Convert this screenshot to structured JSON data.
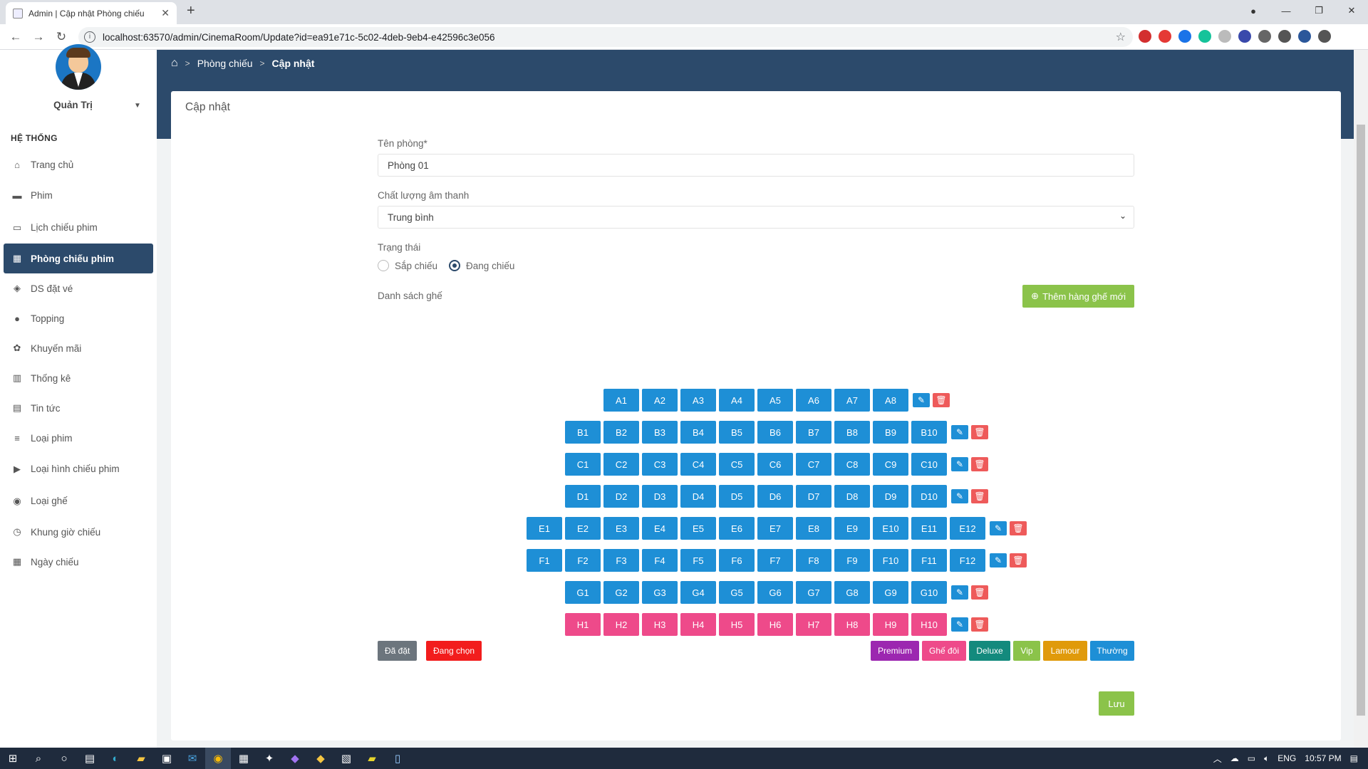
{
  "browser": {
    "tab_title": "Admin | Cập nhật Phòng chiếu",
    "url": "localhost:63570/admin/CinemaRoom/Update?id=ea91e71c-5c02-4deb-9eb4-e42596c3e056"
  },
  "sidebar": {
    "user_name": "Quản Trị",
    "section": "HỆ THỐNG",
    "items": [
      {
        "label": "Trang chủ",
        "icon": "home-icon"
      },
      {
        "label": "Phim",
        "icon": "film-icon"
      },
      {
        "label": "Lịch chiếu phim",
        "icon": "calendar-icon"
      },
      {
        "label": "Phòng chiếu phim",
        "icon": "grid-icon",
        "active": true
      },
      {
        "label": "DS đặt vé",
        "icon": "ticket-icon"
      },
      {
        "label": "Topping",
        "icon": "popcorn-icon"
      },
      {
        "label": "Khuyến mãi",
        "icon": "promo-icon"
      },
      {
        "label": "Thống kê",
        "icon": "chart-icon"
      },
      {
        "label": "Tin tức",
        "icon": "news-icon"
      },
      {
        "label": "Loại phim",
        "icon": "list-icon"
      },
      {
        "label": "Loại hình chiếu phim",
        "icon": "camera-icon"
      },
      {
        "label": "Loại ghế",
        "icon": "seat-icon"
      },
      {
        "label": "Khung giờ chiếu",
        "icon": "clock-icon"
      },
      {
        "label": "Ngày chiếu",
        "icon": "date-icon"
      }
    ]
  },
  "breadcrumb": {
    "item1": "Phòng chiếu",
    "item2": "Cập nhật"
  },
  "card": {
    "title": "Cập nhật",
    "name_label": "Tên phòng*",
    "name_value": "Phòng 01",
    "sound_label": "Chất lượng âm thanh",
    "sound_value": "Trung bình",
    "status_label": "Trạng thái",
    "status_option1": "Sắp chiếu",
    "status_option2": "Đang chiếu",
    "status_selected": "Đang chiếu",
    "seats_label": "Danh sách ghế",
    "add_row_button": "Thêm hàng ghế mới",
    "save_button": "Lưu"
  },
  "seat_rows": [
    {
      "row": "A",
      "count": 8,
      "type": "blue"
    },
    {
      "row": "B",
      "count": 10,
      "type": "blue"
    },
    {
      "row": "C",
      "count": 10,
      "type": "blue"
    },
    {
      "row": "D",
      "count": 10,
      "type": "blue"
    },
    {
      "row": "E",
      "count": 12,
      "type": "blue"
    },
    {
      "row": "F",
      "count": 12,
      "type": "blue"
    },
    {
      "row": "G",
      "count": 10,
      "type": "blue"
    },
    {
      "row": "H",
      "count": 10,
      "type": "pink"
    }
  ],
  "legend_left": [
    {
      "label": "Đã đặt",
      "color": "#6c757d"
    },
    {
      "label": "Đang chọn",
      "color": "#f21d1d"
    }
  ],
  "legend_right": [
    {
      "label": "Premium",
      "color": "#9c27b0"
    },
    {
      "label": "Ghế đôi",
      "color": "#ee4a8a"
    },
    {
      "label": "Deluxe",
      "color": "#138a7d"
    },
    {
      "label": "Vip",
      "color": "#8bc34a"
    },
    {
      "label": "Lamour",
      "color": "#e09a0b"
    },
    {
      "label": "Thường",
      "color": "#1e8fd6"
    }
  ],
  "taskbar": {
    "lang": "ENG",
    "time": "10:57 PM"
  }
}
